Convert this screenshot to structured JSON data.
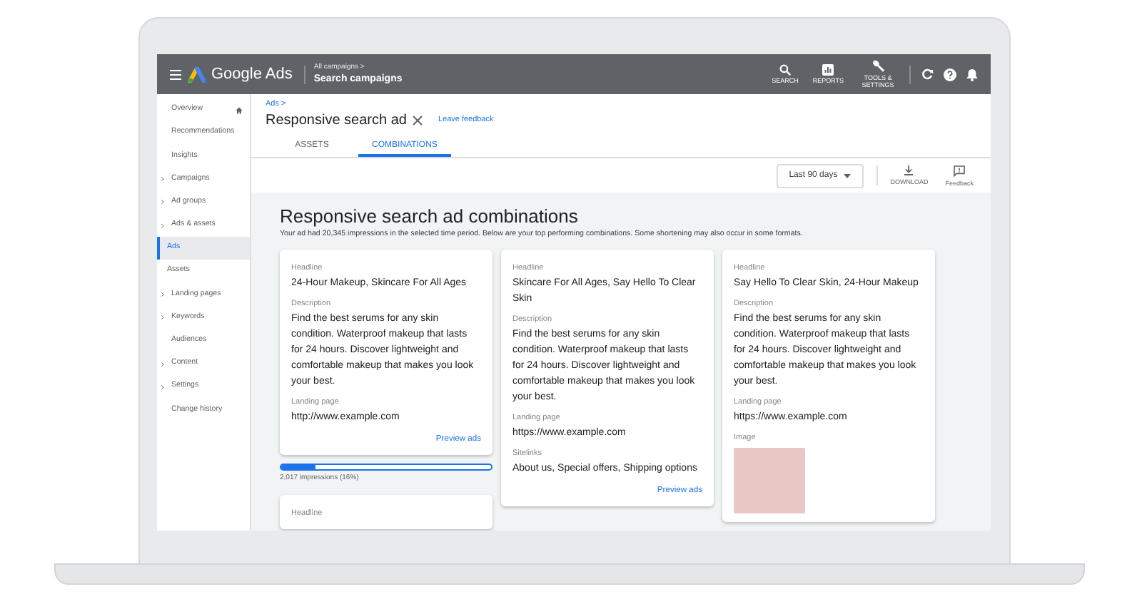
{
  "topbar": {
    "app_name": "Google Ads",
    "breadcrumb_parent": "All campaigns >",
    "campaign": "Search campaigns",
    "tools": [
      {
        "kind": "search",
        "label": "SEARCH"
      },
      {
        "kind": "reports",
        "label": "REPORTS"
      },
      {
        "kind": "tools",
        "label": "TOOLS & SETTINGS"
      }
    ]
  },
  "sidebar": {
    "items": [
      {
        "label": "Overview",
        "kind": "home",
        "selected": false
      },
      {
        "label": "Recommendations",
        "kind": "link",
        "selected": false
      },
      {
        "label": "Insights",
        "kind": "link",
        "selected": false
      },
      {
        "label": "Campaigns",
        "kind": "group",
        "selected": false
      },
      {
        "label": "Ad groups",
        "kind": "group",
        "selected": false
      },
      {
        "label": "Ads & assets",
        "kind": "group",
        "selected": false,
        "children": [
          {
            "label": "Ads",
            "selected": true
          },
          {
            "label": "Assets",
            "selected": false
          }
        ]
      },
      {
        "label": "Landing pages",
        "kind": "group",
        "selected": false
      },
      {
        "label": "Keywords",
        "kind": "group",
        "selected": false
      },
      {
        "label": "Audiences",
        "kind": "link",
        "selected": false
      },
      {
        "label": "Content",
        "kind": "group",
        "selected": false
      },
      {
        "label": "Settings",
        "kind": "group",
        "selected": false
      },
      {
        "label": "Change history",
        "kind": "link",
        "selected": false
      }
    ]
  },
  "header": {
    "breadcrumb": "Ads >",
    "title": "Responsive search ad",
    "feedback_link": "Leave feedback",
    "tabs": [
      {
        "label": "ASSETS",
        "selected": false
      },
      {
        "label": "COMBINATIONS",
        "selected": true
      }
    ]
  },
  "toolbar": {
    "date_range": "Last 90 days",
    "actions": [
      {
        "kind": "download",
        "label": "DOWNLOAD"
      },
      {
        "kind": "feedback",
        "label": "Feedback"
      }
    ]
  },
  "content": {
    "title": "Responsive search ad combinations",
    "subtitle": "Your ad had 20,345 impressions in the selected time period. Below are your top performing combinations. Some shortening may also occur in some formats.",
    "columns": [
      {
        "cards": [
          {
            "sections": [
              {
                "kind": "text",
                "label": "Headline",
                "value": "24-Hour Makeup, Skincare For All Ages"
              },
              {
                "kind": "text",
                "label": "Description",
                "value": "Find the best serums for any skin condition. Waterproof makeup that lasts for 24 hours. Discover lightweight and comfortable makeup that makes you look your best."
              },
              {
                "kind": "text",
                "label": "Landing page",
                "value": "http://www.example.com"
              }
            ],
            "link": "Preview ads",
            "impressions": {
              "level": 0.16,
              "text": "2,017 impressions (16%)"
            }
          },
          {
            "sections": [
              {
                "kind": "text",
                "label": "Headline"
              }
            ]
          }
        ]
      },
      {
        "cards": [
          {
            "sections": [
              {
                "kind": "text",
                "label": "Headline",
                "value": "Skincare For All Ages, Say Hello To Clear Skin"
              },
              {
                "kind": "text",
                "label": "Description",
                "value": "Find the best serums for any skin condition. Waterproof makeup that lasts for 24 hours. Discover lightweight and comfortable makeup that makes you look your best."
              },
              {
                "kind": "text",
                "label": "Landing page",
                "value": "https://www.example.com"
              },
              {
                "kind": "text",
                "label": "Sitelinks",
                "value": "About us, Special offers, Shipping options"
              }
            ],
            "link": "Preview ads"
          }
        ]
      },
      {
        "cards": [
          {
            "sections": [
              {
                "kind": "text",
                "label": "Headline",
                "value": "Say Hello To Clear Skin, 24-Hour Makeup"
              },
              {
                "kind": "text",
                "label": "Description",
                "value": "Find the best serums for any skin condition. Waterproof makeup that lasts for 24 hours. Discover lightweight and comfortable makeup that makes you look your best."
              },
              {
                "kind": "text",
                "label": "Landing page",
                "value": "https://www.example.com"
              },
              {
                "kind": "image",
                "label": "Image"
              }
            ]
          }
        ]
      }
    ]
  }
}
